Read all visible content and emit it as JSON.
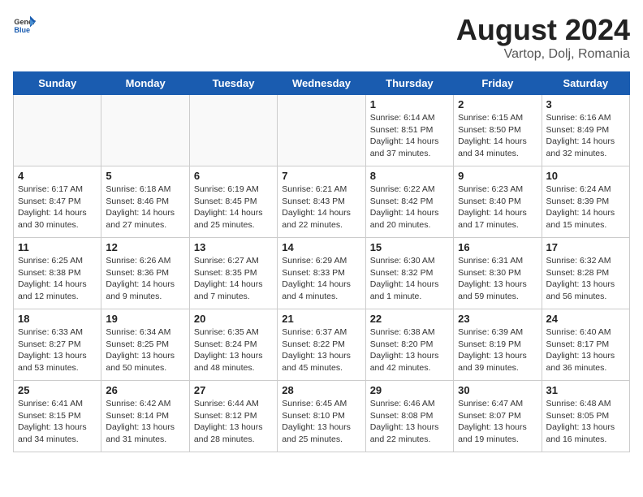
{
  "header": {
    "logo_general": "General",
    "logo_blue": "Blue",
    "title": "August 2024",
    "subtitle": "Vartop, Dolj, Romania"
  },
  "days_of_week": [
    "Sunday",
    "Monday",
    "Tuesday",
    "Wednesday",
    "Thursday",
    "Friday",
    "Saturday"
  ],
  "weeks": [
    [
      {
        "day": "",
        "content": "",
        "shaded": true
      },
      {
        "day": "",
        "content": "",
        "shaded": true
      },
      {
        "day": "",
        "content": "",
        "shaded": true
      },
      {
        "day": "",
        "content": "",
        "shaded": true
      },
      {
        "day": "1",
        "content": "Sunrise: 6:14 AM\nSunset: 8:51 PM\nDaylight: 14 hours\nand 37 minutes.",
        "shaded": false
      },
      {
        "day": "2",
        "content": "Sunrise: 6:15 AM\nSunset: 8:50 PM\nDaylight: 14 hours\nand 34 minutes.",
        "shaded": false
      },
      {
        "day": "3",
        "content": "Sunrise: 6:16 AM\nSunset: 8:49 PM\nDaylight: 14 hours\nand 32 minutes.",
        "shaded": false
      }
    ],
    [
      {
        "day": "4",
        "content": "Sunrise: 6:17 AM\nSunset: 8:47 PM\nDaylight: 14 hours\nand 30 minutes.",
        "shaded": false
      },
      {
        "day": "5",
        "content": "Sunrise: 6:18 AM\nSunset: 8:46 PM\nDaylight: 14 hours\nand 27 minutes.",
        "shaded": false
      },
      {
        "day": "6",
        "content": "Sunrise: 6:19 AM\nSunset: 8:45 PM\nDaylight: 14 hours\nand 25 minutes.",
        "shaded": false
      },
      {
        "day": "7",
        "content": "Sunrise: 6:21 AM\nSunset: 8:43 PM\nDaylight: 14 hours\nand 22 minutes.",
        "shaded": false
      },
      {
        "day": "8",
        "content": "Sunrise: 6:22 AM\nSunset: 8:42 PM\nDaylight: 14 hours\nand 20 minutes.",
        "shaded": false
      },
      {
        "day": "9",
        "content": "Sunrise: 6:23 AM\nSunset: 8:40 PM\nDaylight: 14 hours\nand 17 minutes.",
        "shaded": false
      },
      {
        "day": "10",
        "content": "Sunrise: 6:24 AM\nSunset: 8:39 PM\nDaylight: 14 hours\nand 15 minutes.",
        "shaded": false
      }
    ],
    [
      {
        "day": "11",
        "content": "Sunrise: 6:25 AM\nSunset: 8:38 PM\nDaylight: 14 hours\nand 12 minutes.",
        "shaded": false
      },
      {
        "day": "12",
        "content": "Sunrise: 6:26 AM\nSunset: 8:36 PM\nDaylight: 14 hours\nand 9 minutes.",
        "shaded": false
      },
      {
        "day": "13",
        "content": "Sunrise: 6:27 AM\nSunset: 8:35 PM\nDaylight: 14 hours\nand 7 minutes.",
        "shaded": false
      },
      {
        "day": "14",
        "content": "Sunrise: 6:29 AM\nSunset: 8:33 PM\nDaylight: 14 hours\nand 4 minutes.",
        "shaded": false
      },
      {
        "day": "15",
        "content": "Sunrise: 6:30 AM\nSunset: 8:32 PM\nDaylight: 14 hours\nand 1 minute.",
        "shaded": false
      },
      {
        "day": "16",
        "content": "Sunrise: 6:31 AM\nSunset: 8:30 PM\nDaylight: 13 hours\nand 59 minutes.",
        "shaded": false
      },
      {
        "day": "17",
        "content": "Sunrise: 6:32 AM\nSunset: 8:28 PM\nDaylight: 13 hours\nand 56 minutes.",
        "shaded": false
      }
    ],
    [
      {
        "day": "18",
        "content": "Sunrise: 6:33 AM\nSunset: 8:27 PM\nDaylight: 13 hours\nand 53 minutes.",
        "shaded": false
      },
      {
        "day": "19",
        "content": "Sunrise: 6:34 AM\nSunset: 8:25 PM\nDaylight: 13 hours\nand 50 minutes.",
        "shaded": false
      },
      {
        "day": "20",
        "content": "Sunrise: 6:35 AM\nSunset: 8:24 PM\nDaylight: 13 hours\nand 48 minutes.",
        "shaded": false
      },
      {
        "day": "21",
        "content": "Sunrise: 6:37 AM\nSunset: 8:22 PM\nDaylight: 13 hours\nand 45 minutes.",
        "shaded": false
      },
      {
        "day": "22",
        "content": "Sunrise: 6:38 AM\nSunset: 8:20 PM\nDaylight: 13 hours\nand 42 minutes.",
        "shaded": false
      },
      {
        "day": "23",
        "content": "Sunrise: 6:39 AM\nSunset: 8:19 PM\nDaylight: 13 hours\nand 39 minutes.",
        "shaded": false
      },
      {
        "day": "24",
        "content": "Sunrise: 6:40 AM\nSunset: 8:17 PM\nDaylight: 13 hours\nand 36 minutes.",
        "shaded": false
      }
    ],
    [
      {
        "day": "25",
        "content": "Sunrise: 6:41 AM\nSunset: 8:15 PM\nDaylight: 13 hours\nand 34 minutes.",
        "shaded": false
      },
      {
        "day": "26",
        "content": "Sunrise: 6:42 AM\nSunset: 8:14 PM\nDaylight: 13 hours\nand 31 minutes.",
        "shaded": false
      },
      {
        "day": "27",
        "content": "Sunrise: 6:44 AM\nSunset: 8:12 PM\nDaylight: 13 hours\nand 28 minutes.",
        "shaded": false
      },
      {
        "day": "28",
        "content": "Sunrise: 6:45 AM\nSunset: 8:10 PM\nDaylight: 13 hours\nand 25 minutes.",
        "shaded": false
      },
      {
        "day": "29",
        "content": "Sunrise: 6:46 AM\nSunset: 8:08 PM\nDaylight: 13 hours\nand 22 minutes.",
        "shaded": false
      },
      {
        "day": "30",
        "content": "Sunrise: 6:47 AM\nSunset: 8:07 PM\nDaylight: 13 hours\nand 19 minutes.",
        "shaded": false
      },
      {
        "day": "31",
        "content": "Sunrise: 6:48 AM\nSunset: 8:05 PM\nDaylight: 13 hours\nand 16 minutes.",
        "shaded": false
      }
    ]
  ]
}
